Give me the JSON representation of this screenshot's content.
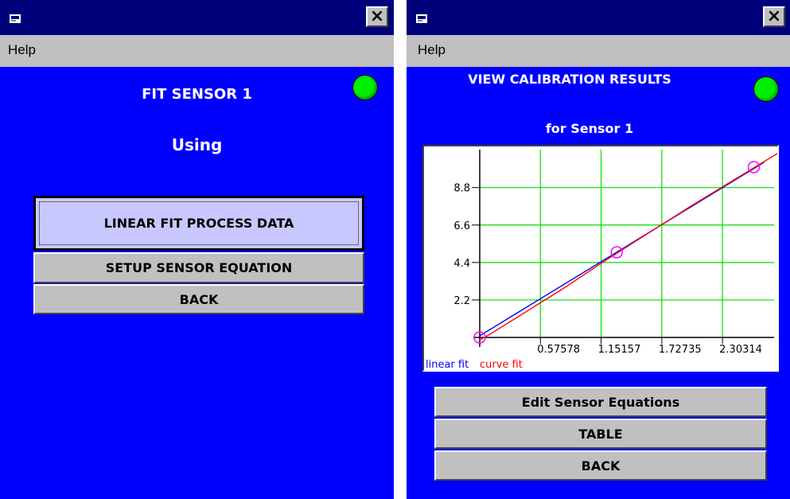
{
  "left_window": {
    "title": "",
    "menu": {
      "help": "Help"
    },
    "heading": "FIT SENSOR 1",
    "subheading": "Using",
    "status_color": "#00ee00",
    "buttons": {
      "linear_fit": "LINEAR FIT PROCESS DATA",
      "setup_equation": "SETUP SENSOR EQUATION",
      "back": "BACK"
    }
  },
  "right_window": {
    "title": "",
    "menu": {
      "help": "Help"
    },
    "heading": "VIEW CALIBRATION RESULTS",
    "subheading": "for Sensor 1",
    "status_color": "#00ee00",
    "buttons": {
      "edit_equations": "Edit Sensor Equations",
      "table": "TABLE",
      "back": "BACK"
    }
  },
  "chart_data": {
    "type": "line",
    "x_ticks": [
      "0.57578",
      "1.15157",
      "1.72735",
      "2.30314"
    ],
    "x_tick_values": [
      0.57578,
      1.15157,
      1.72735,
      2.30314
    ],
    "y_ticks": [
      "2.2",
      "4.4",
      "6.6",
      "8.8"
    ],
    "y_tick_values": [
      2.2,
      4.4,
      6.6,
      8.8
    ],
    "xlim": [
      0,
      2.85
    ],
    "ylim": [
      0,
      11.2
    ],
    "grid": true,
    "series": [
      {
        "name": "linear fit",
        "color": "#0000ff",
        "x": [
          0,
          2.7
        ],
        "y": [
          0.1,
          10.3
        ]
      },
      {
        "name": "curve fit",
        "color": "#ff0000",
        "x": [
          0,
          0.1,
          0.8,
          1.15,
          2.0,
          2.85
        ],
        "y": [
          -0.15,
          0.2,
          2.9,
          4.35,
          7.7,
          10.9
        ]
      }
    ],
    "points": {
      "color": "#ff00ff",
      "x": [
        0,
        1.3,
        2.6
      ],
      "y": [
        0,
        5.0,
        10.0
      ]
    },
    "legend": [
      "linear fit",
      "curve fit"
    ],
    "legend_position": "bottom-left"
  }
}
